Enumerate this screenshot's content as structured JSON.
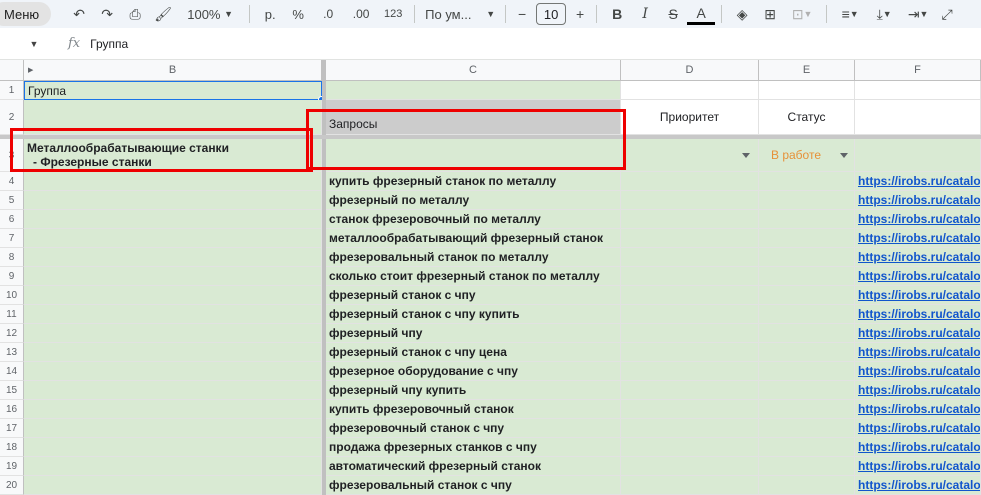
{
  "toolbar": {
    "menu_label": "Меню",
    "zoom": "100%",
    "currency": "р.",
    "percent": "%",
    "dec_decrease": ".0",
    "dec_increase": ".00",
    "number_format": "123",
    "font_name": "По ум...",
    "font_size": "10",
    "bold": "B",
    "italic": "I",
    "strike": "S",
    "text_color": "A",
    "text_color_hex": "#000000"
  },
  "formula_bar": {
    "fx": "fx",
    "content": "Группа"
  },
  "columns": [
    "B",
    "C",
    "D",
    "E",
    "F"
  ],
  "rows": {
    "r1": {
      "num": "1",
      "b": "Группа"
    },
    "r2": {
      "num": "2",
      "c": "Запросы",
      "d": "Приоритет",
      "e": "Статус"
    },
    "r3": {
      "num": "3",
      "b_line1": "Металлообрабатывающие станки",
      "b_line2": "- Фрезерные станки",
      "e": "В работе"
    }
  },
  "data_rows": [
    {
      "num": "4",
      "c": "купить фрезерный станок по металлу",
      "f": "https://irobs.ru/catalo"
    },
    {
      "num": "5",
      "c": "фрезерный по металлу",
      "f": "https://irobs.ru/catalo"
    },
    {
      "num": "6",
      "c": "станок фрезеровочный по металлу",
      "f": "https://irobs.ru/catalo"
    },
    {
      "num": "7",
      "c": "металлообрабатывающий фрезерный станок",
      "f": "https://irobs.ru/catalo"
    },
    {
      "num": "8",
      "c": "фрезеровальный станок по металлу",
      "f": "https://irobs.ru/catalo"
    },
    {
      "num": "9",
      "c": "сколько стоит фрезерный станок по металлу",
      "f": "https://irobs.ru/catalo"
    },
    {
      "num": "10",
      "c": "фрезерный станок с чпу",
      "f": "https://irobs.ru/catalo"
    },
    {
      "num": "11",
      "c": "фрезерный станок с чпу купить",
      "f": "https://irobs.ru/catalo"
    },
    {
      "num": "12",
      "c": "фрезерный чпу",
      "f": "https://irobs.ru/catalo"
    },
    {
      "num": "13",
      "c": "фрезерный станок с чпу цена",
      "f": "https://irobs.ru/catalo"
    },
    {
      "num": "14",
      "c": "фрезерное оборудование с чпу",
      "f": "https://irobs.ru/catalo"
    },
    {
      "num": "15",
      "c": "фрезерный чпу купить",
      "f": "https://irobs.ru/catalo"
    },
    {
      "num": "16",
      "c": "купить фрезеровочный станок",
      "f": "https://irobs.ru/catalo"
    },
    {
      "num": "17",
      "c": "фрезеровочный станок с чпу",
      "f": "https://irobs.ru/catalo"
    },
    {
      "num": "18",
      "c": "продажа фрезерных станков с чпу",
      "f": "https://irobs.ru/catalo"
    },
    {
      "num": "19",
      "c": "автоматический фрезерный станок",
      "f": "https://irobs.ru/catalo"
    },
    {
      "num": "20",
      "c": "фрезеровальный станок с чпу",
      "f": "https://irobs.ru/catalo"
    }
  ],
  "colors": {
    "group_fill": "#d9ead3",
    "header_gray": "#cccccc",
    "status_orange": "#e69138",
    "highlight_red": "#e00000",
    "link_blue": "#1155cc"
  }
}
